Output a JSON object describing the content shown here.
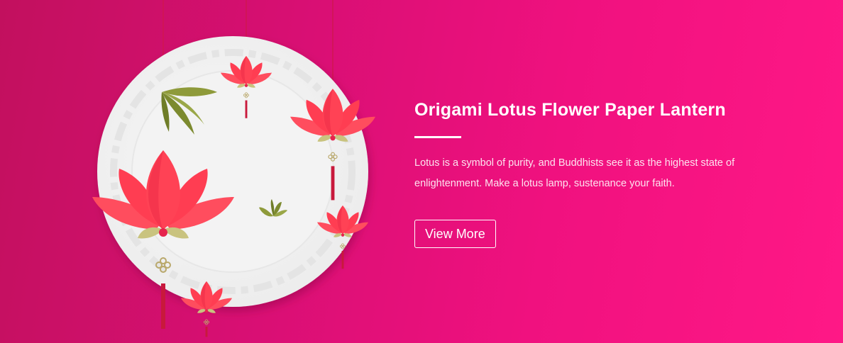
{
  "hero": {
    "title": "Origami Lotus Flower Paper Lantern",
    "description": "Lotus is a symbol of purity, and Buddhists see it as the highest state of enlightenment. Make a lotus lamp, sustenance your faith.",
    "cta_label": "View More"
  },
  "colors": {
    "background_start": "#c2105e",
    "background_end": "#ff1886",
    "lotus_petal": "#ff4457",
    "leaf": "#8e9a3a",
    "plate": "#f4f4f4"
  },
  "icons": [
    "lotus-lantern-icon",
    "bamboo-leaf-icon",
    "chinese-knot-icon"
  ]
}
